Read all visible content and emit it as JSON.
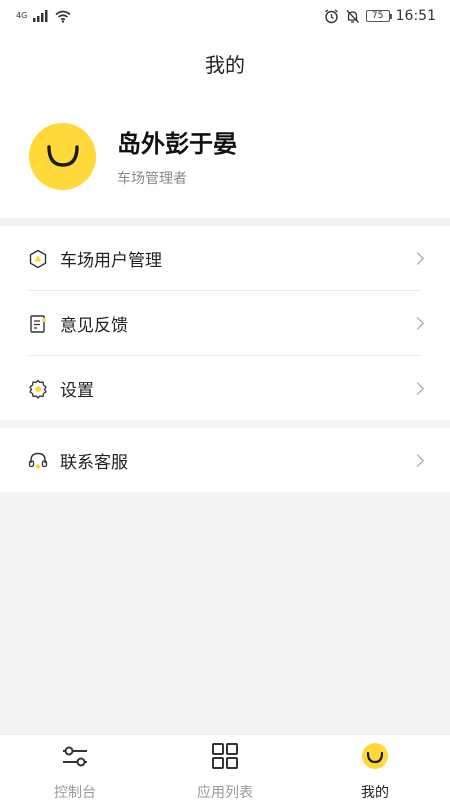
{
  "status_bar": {
    "network": "4G",
    "battery": "75",
    "time": "16:51"
  },
  "header": {
    "title": "我的"
  },
  "profile": {
    "name": "岛外彭于晏",
    "role": "车场管理者"
  },
  "menu": {
    "group1": [
      {
        "label": "车场用户管理",
        "icon": "parking-user-icon"
      },
      {
        "label": "意见反馈",
        "icon": "feedback-icon"
      },
      {
        "label": "设置",
        "icon": "settings-icon"
      }
    ],
    "group2": [
      {
        "label": "联系客服",
        "icon": "headset-icon"
      }
    ]
  },
  "tabbar": {
    "tabs": [
      {
        "label": "控制台",
        "icon": "sliders-icon",
        "active": false
      },
      {
        "label": "应用列表",
        "icon": "grid-icon",
        "active": false
      },
      {
        "label": "我的",
        "icon": "smile-icon",
        "active": true
      }
    ]
  },
  "colors": {
    "accent": "#ffd93a",
    "page_background": "#f2f3f5",
    "text_primary": "#222222",
    "text_secondary": "#888888"
  }
}
